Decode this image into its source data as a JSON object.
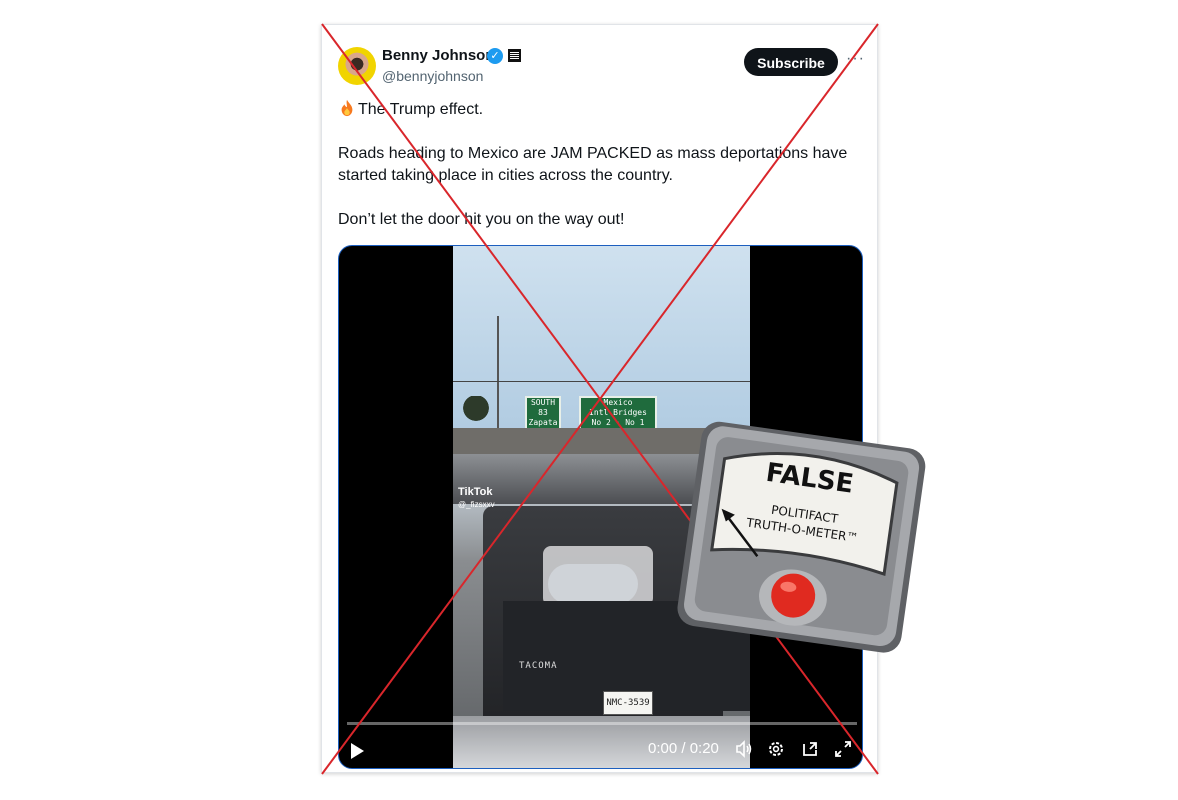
{
  "tweet": {
    "author_name": "Benny Johnson",
    "author_handle": "@bennyjohnson",
    "subscribe_label": "Subscribe",
    "more_label": "···",
    "line1": "The Trump effect.",
    "line2": "Roads heading to Mexico are JAM PACKED as mass deportations have started taking place in cities across the country.",
    "line3": "Don’t let the door hit you on the way out!"
  },
  "video": {
    "time": "0:00 / 0:20",
    "tiktok_label": "TikTok",
    "tiktok_user": "@_fizsxxv",
    "signs": {
      "left": "SOUTH 83 Zapata",
      "right": "Mexico International Bridges No 2 SOUTH No 1"
    },
    "plate": "NMC-3539",
    "vehicle_badge": "TACOMA"
  },
  "rating": {
    "verdict": "FALSE",
    "brand_line1": "POLITIFACT",
    "brand_line2": "TRUTH-O-METER™"
  },
  "icons": [
    "verified-badge-icon",
    "affiliation-icon",
    "fire-emoji-icon",
    "play-icon",
    "volume-icon",
    "settings-icon",
    "pip-icon",
    "fullscreen-icon"
  ],
  "colors": {
    "verified": "#1d9bf0",
    "subscribe_bg": "#0f1419",
    "x_line": "#d9262b",
    "meter_frame": "#8a8c90",
    "meter_button": "#e02a20"
  }
}
